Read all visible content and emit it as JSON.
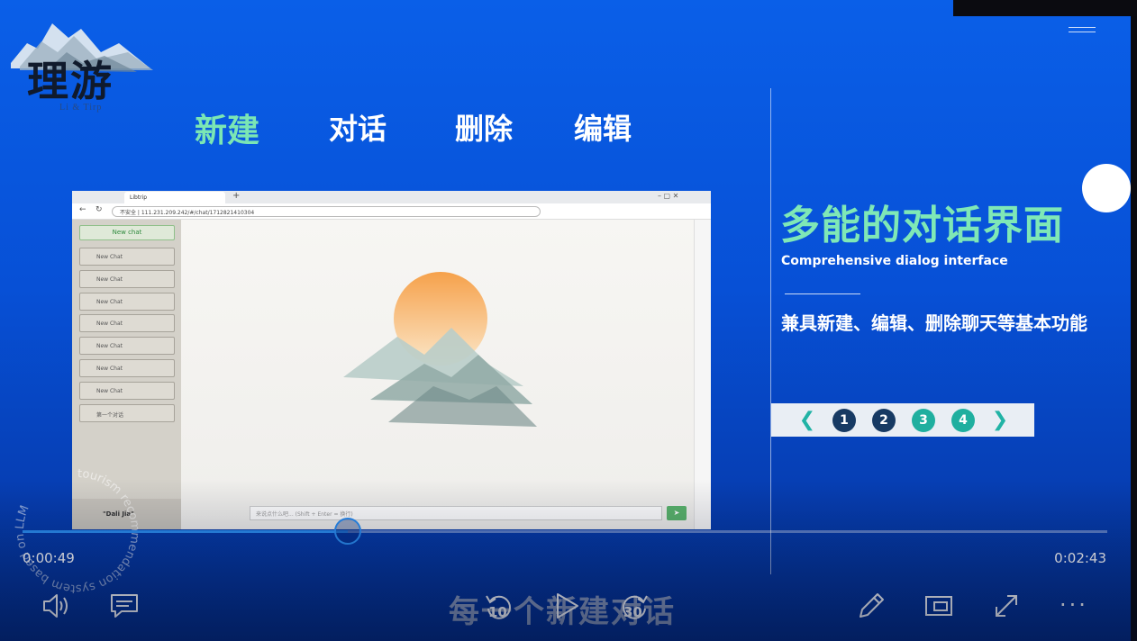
{
  "logo": {
    "text": "理游",
    "subtitle": "Li & Tirp"
  },
  "tabs": [
    {
      "label": "新建",
      "active": true
    },
    {
      "label": "对话",
      "active": false
    },
    {
      "label": "删除",
      "active": false
    },
    {
      "label": "编辑",
      "active": false
    }
  ],
  "panel": {
    "headline": "多能的对话界面",
    "subhead": "Comprehensive dialog interface",
    "description": "兼具新建、编辑、删除聊天等基本功能",
    "pager": {
      "pages": [
        "1",
        "2",
        "3",
        "4"
      ],
      "current": "2",
      "colors": {
        "dark": "#173a63",
        "teal": "#1faf9f",
        "arrow": "#21b3a5"
      }
    }
  },
  "browser": {
    "tab_title": "Libtrip",
    "address": "不安全  |  111.231.209.242/#/chat/1712821410304",
    "new_chat": "New chat",
    "chats": [
      "New Chat",
      "New Chat",
      "New Chat",
      "New Chat",
      "New Chat",
      "New Chat",
      "New Chat",
      "第一个对话"
    ],
    "user": "\"Dali Jia\"",
    "input_placeholder": "来说点什么吧... (Shift + Enter = 换行)"
  },
  "watermark": "tourism recommendation system based on LLM",
  "player": {
    "current_time": "0:00:49",
    "total_time": "0:02:43",
    "progress": 0.3,
    "caption": "每一个新建对话",
    "rewind_seconds": "10",
    "forward_seconds": "30",
    "accent": "#2a8cf0"
  }
}
